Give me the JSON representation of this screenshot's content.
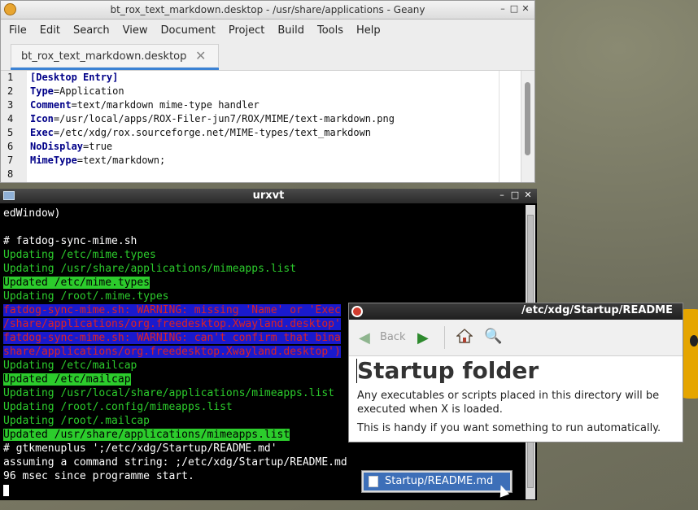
{
  "geany": {
    "title": "bt_rox_text_markdown.desktop - /usr/share/applications - Geany",
    "menu": [
      "File",
      "Edit",
      "Search",
      "View",
      "Document",
      "Project",
      "Build",
      "Tools",
      "Help"
    ],
    "tab_label": "bt_rox_text_markdown.desktop",
    "lines": [
      {
        "n": "1",
        "key": "[Desktop Entry]",
        "val": ""
      },
      {
        "n": "2",
        "key": "Type",
        "val": "=Application"
      },
      {
        "n": "3",
        "key": "Comment",
        "val": "=text/markdown mime-type handler"
      },
      {
        "n": "4",
        "key": "Icon",
        "val": "=/usr/local/apps/ROX-Filer-jun7/ROX/MIME/text-markdown.png"
      },
      {
        "n": "5",
        "key": "Exec",
        "val": "=/etc/xdg/rox.sourceforge.net/MIME-types/text_markdown"
      },
      {
        "n": "6",
        "key": "NoDisplay",
        "val": "=true"
      },
      {
        "n": "7",
        "key": "MimeType",
        "val": "=text/markdown;"
      },
      {
        "n": "8",
        "key": "",
        "val": ""
      }
    ]
  },
  "urxvt": {
    "title": "urxvt",
    "lines": [
      {
        "text": "edWindow)",
        "style": ""
      },
      {
        "text": "",
        "style": ""
      },
      {
        "text": "# fatdog-sync-mime.sh",
        "style": ""
      },
      {
        "text": "Updating /etc/mime.types",
        "style": "g"
      },
      {
        "text": "Updating /usr/share/applications/mimeapps.list",
        "style": "g"
      },
      {
        "text": "Updated /etc/mime.types",
        "style": "hl"
      },
      {
        "text": "Updating /root/.mime.types",
        "style": "g"
      },
      {
        "text": "fatdog-sync-mime.sh: WARNING: missing 'Name' or 'Exec",
        "style": "warn"
      },
      {
        "text": "/share/applications/org.freedesktop.Xwayland.desktop'",
        "style": "warn"
      },
      {
        "text": "fatdog-sync-mime.sh: WARNING: can't confirm that bina",
        "style": "warn"
      },
      {
        "text": "share/applications/org.freedesktop.Xwayland.desktop')",
        "style": "warn"
      },
      {
        "text": "Updating /etc/mailcap",
        "style": "g"
      },
      {
        "text": "Updated /etc/mailcap",
        "style": "hl"
      },
      {
        "text": "Updating /usr/local/share/applications/mimeapps.list",
        "style": "g"
      },
      {
        "text": "Updating /root/.config/mimeapps.list",
        "style": "g"
      },
      {
        "text": "Updating /root/.mailcap",
        "style": "g"
      },
      {
        "text": "Updated /usr/share/applications/mimeapps.list",
        "style": "hl"
      },
      {
        "text": "# gtkmenuplus ';/etc/xdg/Startup/README.md'",
        "style": ""
      },
      {
        "text": "assuming a command string: ;/etc/xdg/Startup/README.md",
        "style": ""
      },
      {
        "text": "96 msec since programme start.",
        "style": ""
      }
    ]
  },
  "readme": {
    "title": "/etc/xdg/Startup/README",
    "back_label": "Back",
    "heading": "Startup folder",
    "para1": "Any executables or scripts placed in this directory will be executed when X is loaded.",
    "para2": "This is handy if you want something to run automatically."
  },
  "popup": {
    "label": "Startup/README.md"
  },
  "colors": {
    "term_green": "#2ccc2c",
    "term_warn_bg": "#1a1acd",
    "term_warn_fg": "#dd2222",
    "accent_blue": "#3b82d4"
  }
}
